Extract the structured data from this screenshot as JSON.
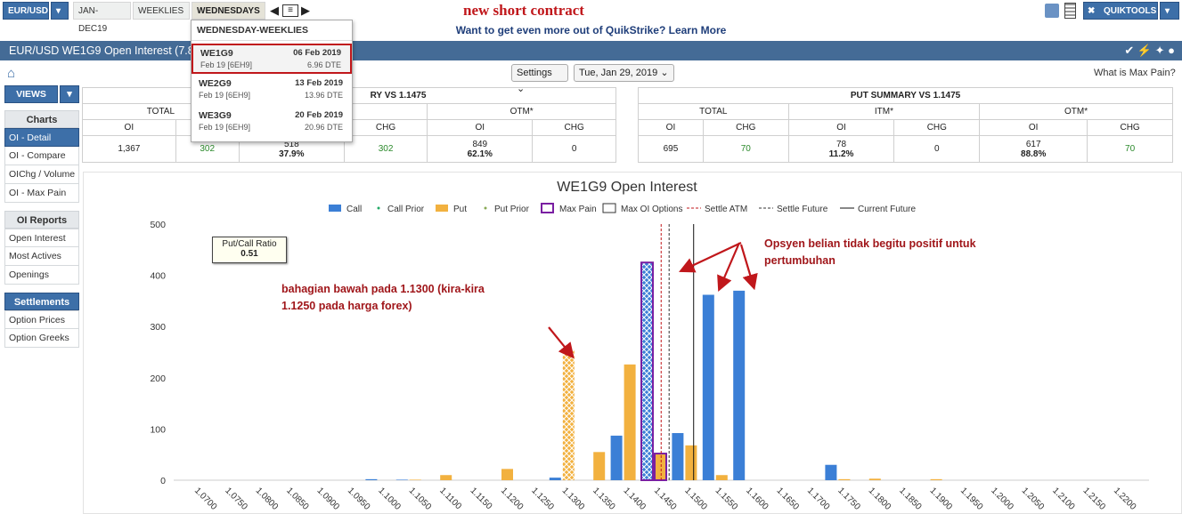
{
  "topbar": {
    "pair": "EUR/USD",
    "tabs": [
      "JAN-DEC19",
      "WEEKLIES",
      "WEDNESDAYS"
    ],
    "quiktools": "QUIKTOOLS"
  },
  "annotation_top": "new short contract",
  "banner": "Want to get even more out of QuikStrike? Learn More",
  "titlebar": {
    "title": "EUR/USD WE1G9 Open Interest (7.8"
  },
  "home_icon": "home-icon",
  "controls": {
    "settings": "Settings",
    "date": "Tue, Jan 29, 2019",
    "max_pain_link": "What is Max Pain?"
  },
  "sidebar": {
    "views": "VIEWS",
    "charts_head": "Charts",
    "charts": [
      "OI - Detail",
      "OI - Compare",
      "OIChg / Volume",
      "OI - Max Pain"
    ],
    "reports_head": "OI Reports",
    "reports": [
      "Open Interest",
      "Most Actives",
      "Openings"
    ],
    "settlements_head": "Settlements",
    "settlements": [
      "Option Prices",
      "Option Greeks"
    ]
  },
  "dropdown": {
    "title": "WEDNESDAY-WEEKLIES",
    "items": [
      {
        "name": "WE1G9",
        "date": "06 Feb 2019",
        "sub": "Feb 19  [6EH9]",
        "dte": "6.96 DTE"
      },
      {
        "name": "WE2G9",
        "date": "13 Feb 2019",
        "sub": "Feb 19  [6EH9]",
        "dte": "13.96 DTE"
      },
      {
        "name": "WE3G9",
        "date": "20 Feb 2019",
        "sub": "Feb 19  [6EH9]",
        "dte": "20.96 DTE"
      }
    ]
  },
  "call_summary": {
    "title_partial": "RY VS 1.1475",
    "groups": [
      "TOTAL",
      "M*",
      "OTM*"
    ],
    "cols": [
      "OI",
      "",
      "",
      "CHG",
      "OI",
      "CHG"
    ],
    "values": [
      "1,367",
      "302",
      "518",
      "302",
      "849",
      "0"
    ],
    "pct_itm": "37.9%",
    "pct_otm": "62.1%"
  },
  "put_summary": {
    "title": "PUT SUMMARY VS 1.1475",
    "groups": [
      "TOTAL",
      "ITM*",
      "OTM*"
    ],
    "cols": [
      "OI",
      "CHG",
      "OI",
      "CHG",
      "OI",
      "CHG"
    ],
    "values": [
      "695",
      "70",
      "78",
      "0",
      "617",
      "70"
    ],
    "pct_itm": "11.2%",
    "pct_otm": "88.8%"
  },
  "colors": {
    "call": "#3b7fd6",
    "put": "#f2b13f",
    "max_pain": "#7a1fa2",
    "title_bar": "#446b96",
    "annotation": "#c0171b"
  },
  "chart_data": {
    "type": "bar",
    "title": "WE1G9 Open Interest",
    "legend": [
      "Call",
      "Call Prior",
      "Put",
      "Put Prior",
      "Max Pain",
      "Max OI Options",
      "Settle ATM",
      "Settle Future",
      "Current Future"
    ],
    "ylim": [
      0,
      500
    ],
    "yticks": [
      "0",
      "100",
      "200",
      "300",
      "400",
      "500"
    ],
    "categories": [
      "1.0700",
      "1.0750",
      "1.0800",
      "1.0850",
      "1.0900",
      "1.0950",
      "1.1000",
      "1.1050",
      "1.1100",
      "1.1150",
      "1.1200",
      "1.1250",
      "1.1300",
      "1.1350",
      "1.1400",
      "1.1450",
      "1.1500",
      "1.1550",
      "1.1600",
      "1.1650",
      "1.1700",
      "1.1750",
      "1.1800",
      "1.1850",
      "1.1900",
      "1.1950",
      "1.2000",
      "1.2050",
      "1.2100",
      "1.2150",
      "1.2200"
    ],
    "xtick_labels": [
      "1.0700",
      "1.0750",
      "1.0800",
      "1.0850",
      "1.0900",
      "1.0950",
      "1.1000",
      "1.1050",
      "1.1100",
      "1.1150",
      "1.1200",
      "1.1250",
      "1.1300",
      "1.1350",
      "1.1400",
      "1.1450",
      "1.1500",
      "1.1550",
      "1.1600",
      "1.1650",
      "1.1700",
      "1.1750",
      "1.1800",
      "1.1850",
      "1.1900",
      "1.1950",
      "1.2000",
      "1.2050",
      "1.2100",
      "1.2150",
      "1.2200"
    ],
    "series": [
      {
        "name": "Call",
        "values": [
          0,
          0,
          0,
          0,
          0,
          0,
          2,
          1,
          0,
          0,
          0,
          0,
          5,
          0,
          87,
          425,
          92,
          362,
          370,
          0,
          0,
          30,
          0,
          0,
          0,
          0,
          0,
          0,
          0,
          0,
          0
        ]
      },
      {
        "name": "Put",
        "values": [
          0,
          0,
          0,
          0,
          0,
          0,
          0,
          1,
          10,
          0,
          22,
          0,
          253,
          55,
          226,
          52,
          68,
          10,
          0,
          0,
          0,
          2,
          3,
          0,
          2,
          0,
          0,
          0,
          0,
          0,
          0
        ]
      }
    ],
    "max_oi_strikes": [
      "1.1300",
      "1.1450"
    ],
    "max_pain_strike": "1.1450",
    "settle_atm": 1.1462,
    "settle_future": 1.1475,
    "current_future": 1.1515,
    "put_call_ratio_label": "Put/Call Ratio",
    "put_call_ratio": "0.51",
    "annotations": [
      {
        "text": "bahagian bawah pada 1.1300 (kira-kira 1.1250 pada harga forex)"
      },
      {
        "text": "Opsyen belian tidak begitu positif untuk pertumbuhan"
      }
    ]
  }
}
